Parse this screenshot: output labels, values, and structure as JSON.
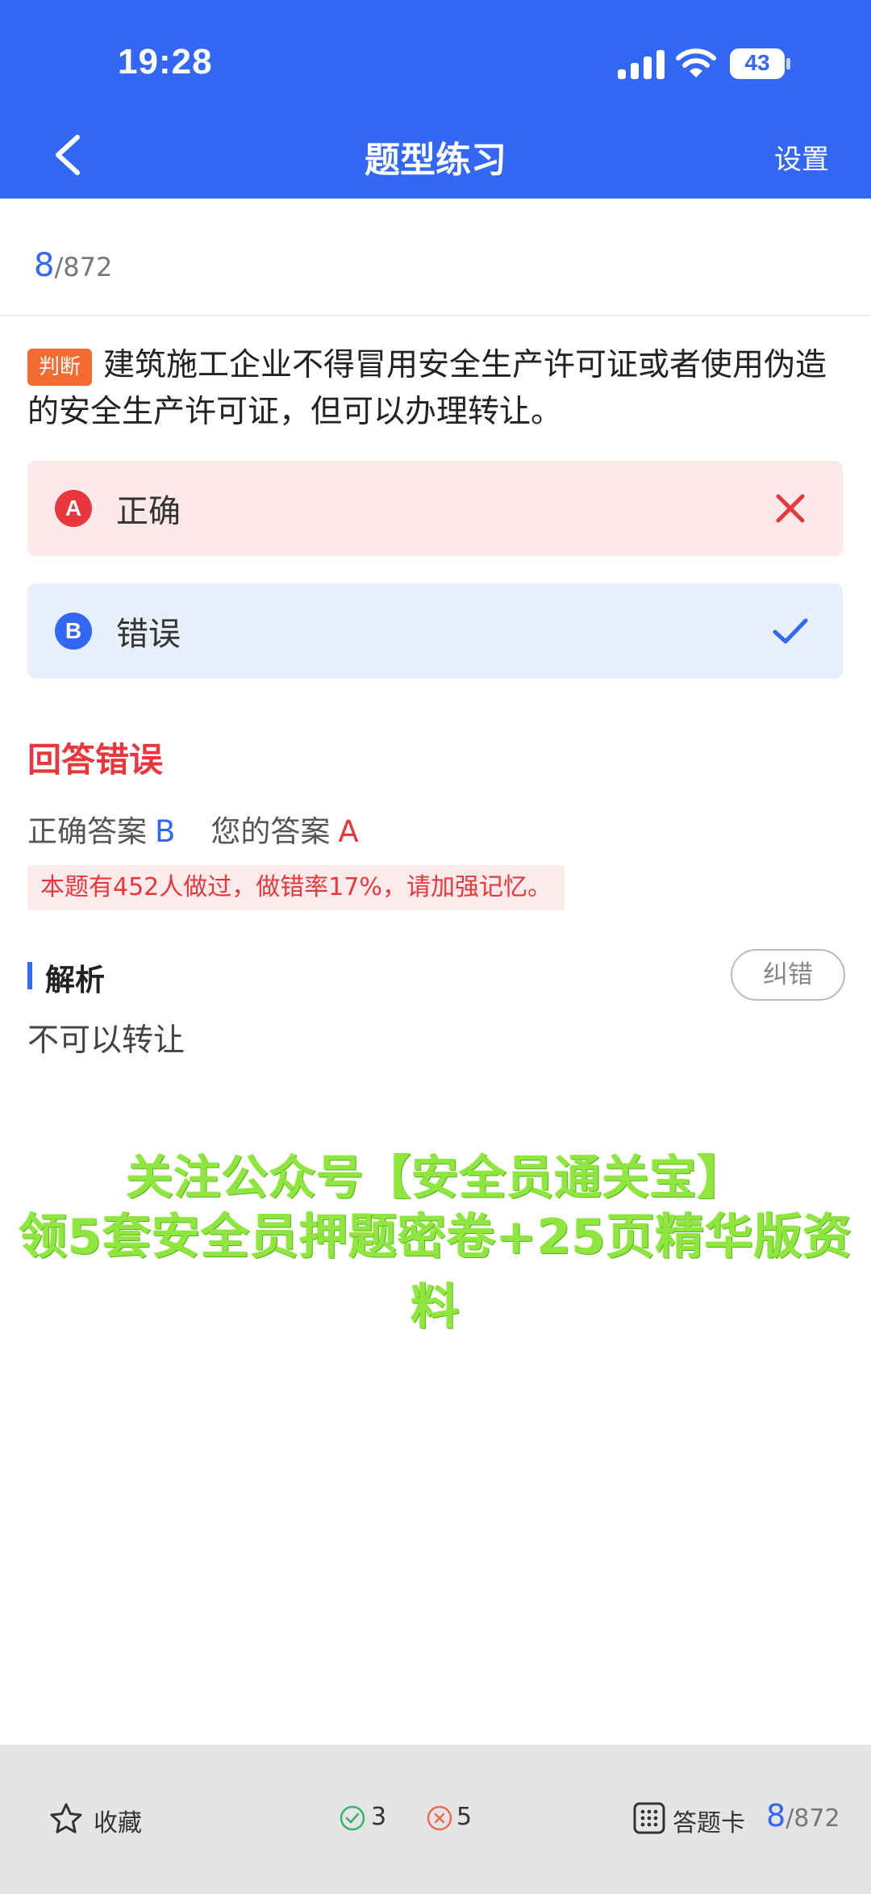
{
  "status": {
    "time": "19:28",
    "battery": "43"
  },
  "nav": {
    "title": "题型练习",
    "settings": "设置"
  },
  "progress": {
    "current": "8",
    "total": "/872"
  },
  "question": {
    "type": "判断",
    "text": "建筑施工企业不得冒用安全生产许可证或者使用伪造的安全生产许可证，但可以办理转让。"
  },
  "options": [
    {
      "letter": "A",
      "text": "正确",
      "state": "wrong"
    },
    {
      "letter": "B",
      "text": "错误",
      "state": "correct"
    }
  ],
  "result": {
    "title": "回答错误",
    "correct_label": "正确答案",
    "correct_value": "B",
    "your_label": "您的答案",
    "your_value": "A",
    "stat": "本题有452人做过，做错率17%，请加强记忆。"
  },
  "analysis": {
    "title": "解析",
    "correct_button": "纠错",
    "text": "不可以转让"
  },
  "promo": {
    "line1": "关注公众号【安全员通关宝】",
    "line2": "领5套安全员押题密卷+25页精华版资料"
  },
  "bottom": {
    "favorite": "收藏",
    "right_count": "3",
    "wrong_count": "5",
    "answer_card": "答题卡",
    "current": "8",
    "total": "/872"
  },
  "colors": {
    "primary": "#3367f6",
    "error": "#e8383d",
    "promo": "#8fe63f"
  }
}
